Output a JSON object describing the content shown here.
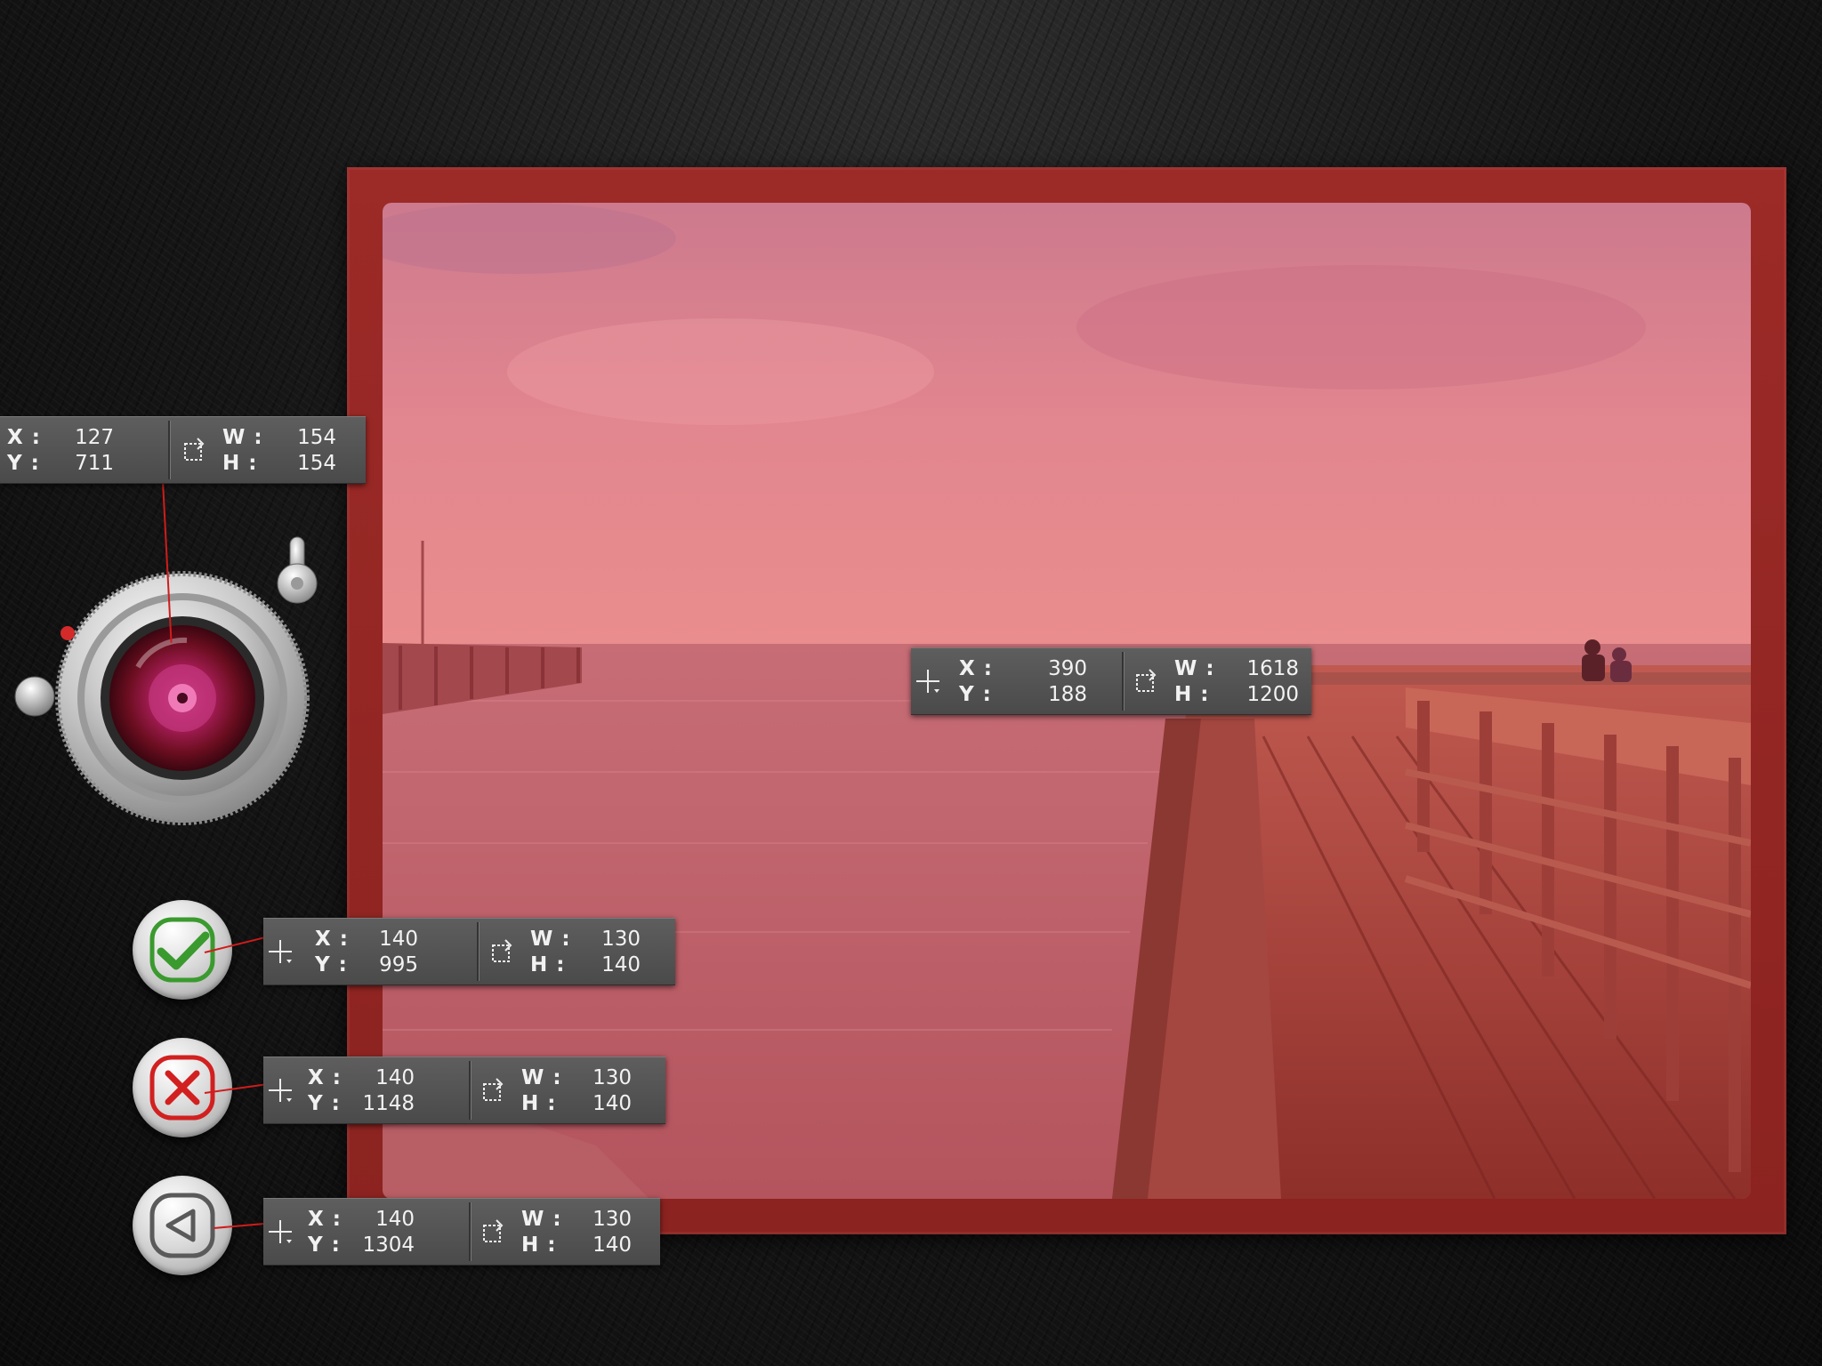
{
  "tags": {
    "lens": {
      "x_label": "X :",
      "x": "127",
      "y_label": "Y :",
      "y": "711",
      "w_label": "W :",
      "w": "154",
      "h_label": "H :",
      "h": "154"
    },
    "photo": {
      "x_label": "X :",
      "x": "390",
      "y_label": "Y :",
      "y": "188",
      "w_label": "W :",
      "w": "1618",
      "h_label": "H :",
      "h": "1200"
    },
    "accept": {
      "x_label": "X :",
      "x": "140",
      "y_label": "Y :",
      "y": "995",
      "w_label": "W :",
      "w": "130",
      "h_label": "H :",
      "h": "140"
    },
    "cancel": {
      "x_label": "X :",
      "x": "140",
      "y_label": "Y :",
      "y": "1148",
      "w_label": "W :",
      "w": "130",
      "h_label": "H :",
      "h": "140"
    },
    "back": {
      "x_label": "X :",
      "x": "140",
      "y_label": "Y :",
      "y": "1304",
      "w_label": "W :",
      "w": "130",
      "h_label": "H :",
      "h": "140"
    }
  },
  "icons": {
    "accept": "checkmark-icon",
    "cancel": "x-icon",
    "back": "triangle-left-icon",
    "move": "crosshair-icon",
    "resize": "resize-icon"
  },
  "colors": {
    "frame": "#8f2522",
    "overlay": "#e8848a",
    "accept": "#3a9a2e",
    "cancel": "#d22020",
    "connector": "#d01c1c"
  }
}
